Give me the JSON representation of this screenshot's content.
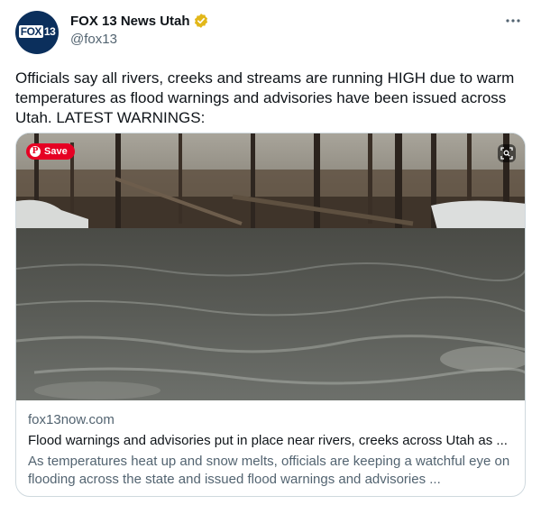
{
  "account": {
    "display_name": "FOX 13 News Utah",
    "handle": "@fox13",
    "avatar_logo_text": "FOX13",
    "verified_badge_color": "#e2b719"
  },
  "tweet": {
    "text": "Officials say all rivers, creeks and streams are running HIGH due to warm temperatures as flood warnings and advisories have been issued across Utah. LATEST WARNINGS:"
  },
  "card": {
    "save_label": "Save",
    "domain": "fox13now.com",
    "title": "Flood warnings and advisories put in place near rivers, creeks across Utah as ...",
    "description": "As temperatures heat up and snow melts, officials are keeping a watchful eye on flooding across the state and issued flood warnings and advisories ..."
  },
  "icons": {
    "more": "more-dots-icon",
    "verified": "verified-badge-icon",
    "pinterest": "pinterest-icon",
    "lens": "visual-search-icon"
  },
  "colors": {
    "text_primary": "#0f1419",
    "text_secondary": "#536471",
    "card_border": "#cfd9de",
    "pinterest_red": "#e60023",
    "avatar_bg": "#0b2f5c"
  }
}
